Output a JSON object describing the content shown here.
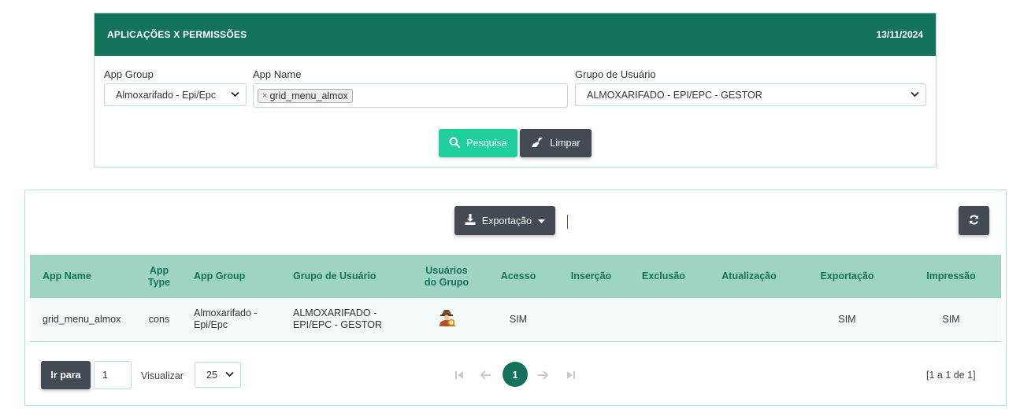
{
  "header": {
    "title": "APLICAÇÕES X PERMISSÕES",
    "date": "13/11/2024"
  },
  "filters": {
    "app_group": {
      "label": "App Group",
      "value": "Almoxarifado - Epi/Epc"
    },
    "app_name": {
      "label": "App Name",
      "tag": "grid_menu_almox"
    },
    "grupo_usuario": {
      "label": "Grupo de Usuário",
      "value": "ALMOXARIFADO - EPI/EPC - GESTOR"
    },
    "search_button": "Pesquisa",
    "clear_button": "Limpar"
  },
  "toolbar": {
    "export_button": "Exportação"
  },
  "table": {
    "columns": [
      "App Name",
      "App Type",
      "App Group",
      "Grupo de Usuário",
      "Usuários do Grupo",
      "Acesso",
      "Inserção",
      "Exclusão",
      "Atualização",
      "Exportação",
      "Impressão"
    ],
    "rows": [
      {
        "app_name": "grid_menu_almox",
        "app_type": "cons",
        "app_group": "Almoxarifado - Epi/Epc",
        "grupo_usuario": "ALMOXARIFADO - EPI/EPC - GESTOR",
        "usuarios_icon": "user-search-icon",
        "acesso": "SIM",
        "insercao": "",
        "exclusao": "",
        "atualizacao": "",
        "exportacao": "SIM",
        "impressao": "SIM"
      }
    ]
  },
  "pagination": {
    "goto_label": "Ir para",
    "goto_value": "1",
    "view_label": "Visualizar",
    "page_size": "25",
    "current_page": "1",
    "summary": "[1 a 1 de 1]"
  },
  "colors": {
    "brand": "#13735a",
    "header_row": "#9fd4c2",
    "search": "#1fd09d",
    "dark_button": "#434a54"
  }
}
